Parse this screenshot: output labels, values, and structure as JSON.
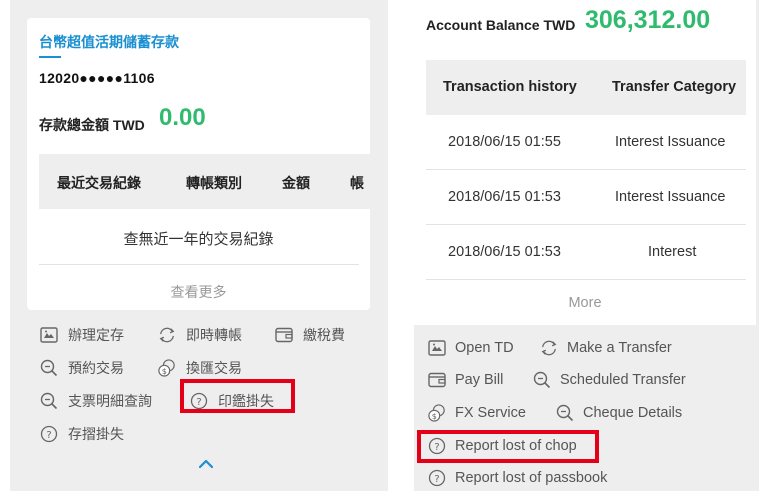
{
  "left": {
    "account_name": "台幣超值活期儲蓄存款",
    "account_number": "12020●●●●●1106",
    "balance_label": "存款總金額 TWD",
    "balance_value": "0.00",
    "table_headers": [
      "最近交易紀錄",
      "轉帳類別",
      "金額",
      "帳"
    ],
    "empty_text": "查無近一年的交易紀錄",
    "more_label": "查看更多",
    "services": [
      {
        "label": "辦理定存",
        "icon": "deposit-icon"
      },
      {
        "label": "即時轉帳",
        "icon": "transfer-icon"
      },
      {
        "label": "繳稅費",
        "icon": "wallet-icon"
      },
      {
        "label": "預約交易",
        "icon": "search-icon"
      },
      {
        "label": "換匯交易",
        "icon": "exchange-icon"
      },
      {
        "label": "支票明細查詢",
        "icon": "search-icon"
      },
      {
        "label": "印鑑掛失",
        "icon": "help-circle-icon"
      },
      {
        "label": "存摺掛失",
        "icon": "help-circle-icon"
      }
    ],
    "highlighted_service": "印鑑掛失"
  },
  "right": {
    "balance_label": "Account Balance TWD",
    "balance_value": "306,312.00",
    "table_headers": [
      "Transaction history",
      "Transfer Category"
    ],
    "rows": [
      {
        "date": "2018/06/15 01:55",
        "category": "Interest Issuance"
      },
      {
        "date": "2018/06/15 01:53",
        "category": "Interest Issuance"
      },
      {
        "date": "2018/06/15 01:53",
        "category": "Interest"
      }
    ],
    "more_label": "More",
    "services": [
      {
        "label": "Open TD",
        "icon": "deposit-icon"
      },
      {
        "label": "Make a Transfer",
        "icon": "transfer-icon"
      },
      {
        "label": "Pay Bill",
        "icon": "wallet-icon"
      },
      {
        "label": "Scheduled Transfer",
        "icon": "search-icon"
      },
      {
        "label": "FX Service",
        "icon": "exchange-icon"
      },
      {
        "label": "Cheque Details",
        "icon": "search-icon"
      },
      {
        "label": "Report lost of chop",
        "icon": "help-circle-icon"
      },
      {
        "label": "Report lost of passbook",
        "icon": "help-circle-icon"
      }
    ],
    "highlighted_service": "Report lost of chop"
  },
  "colors": {
    "accent_blue": "#1a8fd1",
    "balance_green": "#2fbb6e",
    "highlight_red": "#e5001a"
  }
}
